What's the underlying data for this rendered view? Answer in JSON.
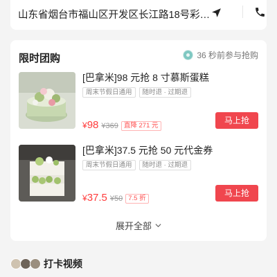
{
  "address": {
    "text": "山东省烟台市福山区开发区长江路18号彩…"
  },
  "deals_section": {
    "title": "限时团购",
    "live_text": "36 秒前参与抢购",
    "expand_label": "展开全部",
    "deals": [
      {
        "title": "[巴拿米]98 元抢 8 寸慕斯蛋糕",
        "tags": [
          "周末节假日通用",
          "随时退 · 过期退"
        ],
        "price_symbol": "¥",
        "price": "98",
        "original_price": "¥369",
        "discount_badge": "直降 271 元",
        "buy_label": "马上抢"
      },
      {
        "title": "[巴拿米]37.5 元抢 50 元代金券",
        "tags": [
          "周末节假日通用",
          "随时退 · 过期退"
        ],
        "price_symbol": "¥",
        "price": "37.5",
        "original_price": "¥50",
        "discount_badge": "7.5 折",
        "buy_label": "马上抢"
      }
    ]
  },
  "video_section": {
    "title": "打卡视频"
  },
  "colors": {
    "accent_red": "#f0464e",
    "price_red": "#ff3b3b",
    "background": "#f4f4f4"
  },
  "icons": [
    "navigation-arrow-icon",
    "phone-icon",
    "chevron-down-icon"
  ]
}
